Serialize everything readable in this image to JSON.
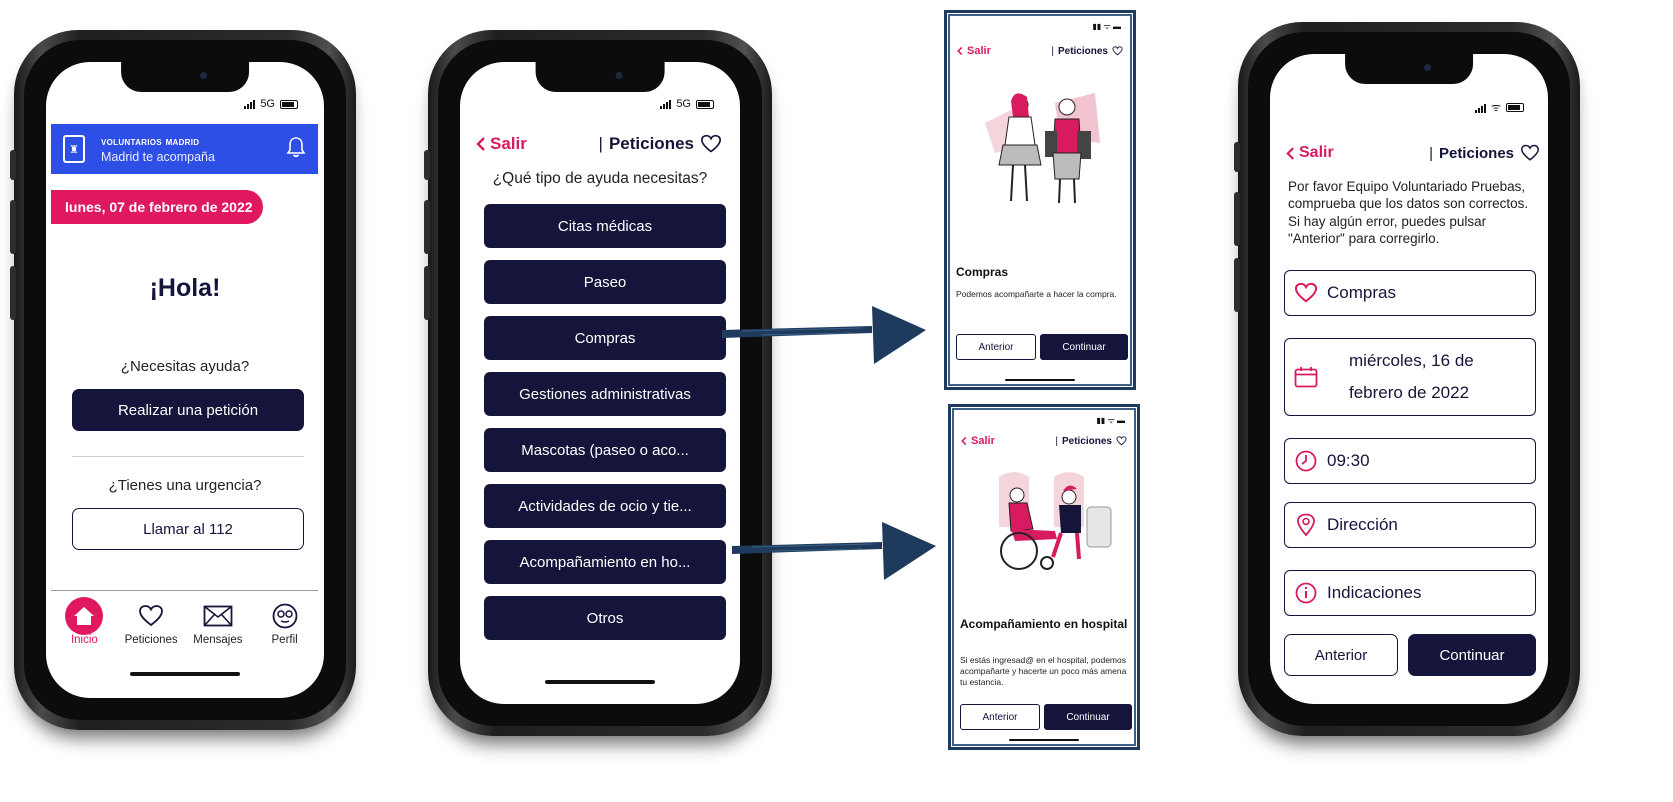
{
  "colors": {
    "navy": "#15143a",
    "pink": "#e0185f",
    "brand_blue": "#2d4fe6",
    "arrow": "#1e3a5c"
  },
  "screen1": {
    "status_net": "5G",
    "brand_title": "voluntarios madrid",
    "brand_sub": "Madrid te acompaña",
    "date": "lunes, 07 de febrero de 2022",
    "greeting": "¡Hola!",
    "help_question": "¿Necesitas ayuda?",
    "request_button": "Realizar una petición",
    "urgent_question": "¿Tienes una urgencia?",
    "call_button": "Llamar al 112",
    "tabs": [
      {
        "label": "Inicio",
        "icon": "home-icon"
      },
      {
        "label": "Peticiones",
        "icon": "heart-icon"
      },
      {
        "label": "Mensajes",
        "icon": "mail-icon"
      },
      {
        "label": "Perfil",
        "icon": "profile-icon"
      }
    ]
  },
  "screen2": {
    "status_net": "5G",
    "back": "Salir",
    "section": "Peticiones",
    "question": "¿Qué tipo de ayuda necesitas?",
    "options": [
      "Citas médicas",
      "Paseo",
      "Compras",
      "Gestiones administrativas",
      "Mascotas (paseo o aco...",
      "Actividades de ocio y tie...",
      "Acompañamiento en ho...",
      "Otros"
    ]
  },
  "screen3": {
    "back": "Salir",
    "section": "Peticiones",
    "title": "Compras",
    "description": "Podemos acompañarte a hacer la compra.",
    "prev": "Anterior",
    "next": "Continuar"
  },
  "screen4": {
    "back": "Salir",
    "section": "Peticiones",
    "title": "Acompañamiento en hospital",
    "description": "Si estás ingresad@ en el hospital, podemos acompañarte y hacerte un poco más amena tu estancia.",
    "prev": "Anterior",
    "next": "Continuar"
  },
  "screen5": {
    "back": "Salir",
    "section": "Peticiones",
    "intro": "Por favor Equipo Voluntariado Pruebas, comprueba que los datos son correctos. Si hay algún error, puedes pulsar \"Anterior\" para corregirlo.",
    "category": "Compras",
    "date_line1": "miércoles, 16 de",
    "date_line2": "febrero de 2022",
    "time": "09:30",
    "address": "Dirección",
    "notes": "Indicaciones",
    "prev": "Anterior",
    "next": "Continuar"
  }
}
